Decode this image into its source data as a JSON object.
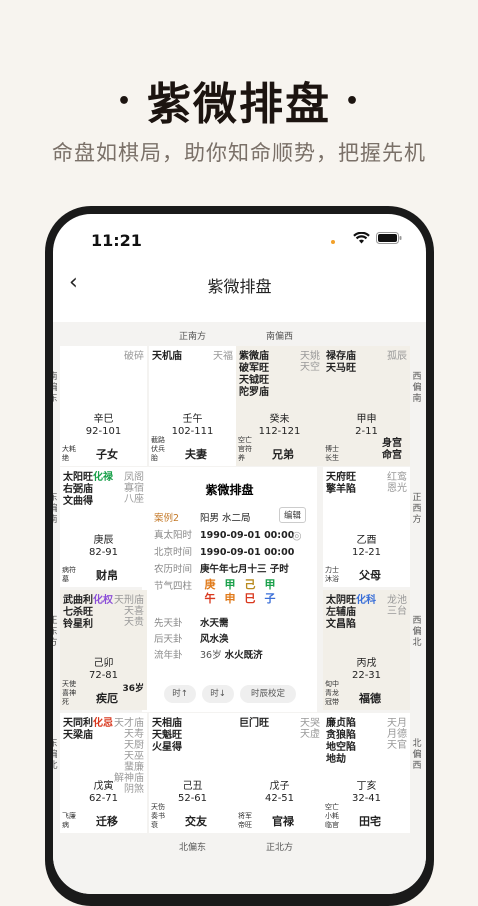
{
  "hero": {
    "title": "紫微排盘",
    "dot": "•",
    "subtitle": "命盘如棋局，助你知命顺势，把握先机"
  },
  "status": {
    "time": "11:21"
  },
  "nav": {
    "back": "‹",
    "title": "紫微排盘"
  },
  "directions": {
    "top": [
      "正南方",
      "南偏西"
    ],
    "bottom": [
      "北偏东",
      "正北方"
    ],
    "left": [
      "南偏东",
      "东偏南",
      "正东方",
      "东偏北"
    ],
    "right": [
      "西偏南",
      "正西方",
      "西偏北",
      "北偏西"
    ]
  },
  "cells": [
    {
      "id": "si",
      "stars": [],
      "minor": [
        "破碎"
      ],
      "gz": "辛巳",
      "range": "92-101",
      "bl": [
        "大耗",
        "绝"
      ],
      "palace": "子女"
    },
    {
      "id": "wu",
      "stars": [
        "天机庙"
      ],
      "minor": [
        "天福"
      ],
      "gz": "壬午",
      "range": "102-111",
      "bl": [
        "截路",
        "伏兵",
        "胎"
      ],
      "palace": "夫妻"
    },
    {
      "id": "wei",
      "stars": [
        "紫微庙",
        "破军旺",
        "天钺旺",
        "陀罗庙"
      ],
      "minor": [
        "天姚",
        "天空"
      ],
      "gz": "癸未",
      "range": "112-121",
      "bl": [
        "空亡",
        "官符",
        "养"
      ],
      "palace": "兄弟"
    },
    {
      "id": "shen",
      "stars": [
        "禄存庙",
        "天马旺"
      ],
      "minor": [
        "孤辰"
      ],
      "gz": "甲申",
      "range": "2-11",
      "bl": [
        "博士",
        "长生"
      ],
      "palace": "身宫",
      "palace2": "命宫"
    },
    {
      "id": "chen",
      "stars": [
        "太阳旺",
        "右弼庙",
        "文曲得"
      ],
      "hua": "化禄",
      "minor": [
        "凤阁",
        "寡宿",
        "八座"
      ],
      "gz": "庚辰",
      "range": "82-91",
      "bl": [
        "病符",
        "墓"
      ],
      "palace": "财帛"
    },
    {
      "id": "you",
      "stars": [
        "天府旺",
        "擎羊陷"
      ],
      "minor": [
        "红鸾",
        "恩光"
      ],
      "gz": "乙酉",
      "range": "12-21",
      "bl": [
        "力士",
        "沐浴"
      ],
      "palace": "父母"
    },
    {
      "id": "mao",
      "stars": [
        "武曲利",
        "七杀旺",
        "铃星利"
      ],
      "hua": "化权",
      "minor": [
        "天刑庙",
        "天喜",
        "天贵"
      ],
      "gz": "己卯",
      "range": "72-81",
      "age": "36岁",
      "bl": [
        "天使",
        "喜神",
        "死"
      ],
      "palace": "疾厄"
    },
    {
      "id": "xu",
      "stars": [
        "太阴旺",
        "左辅庙",
        "文昌陷"
      ],
      "hua": "化科",
      "minor": [
        "龙池",
        "三台"
      ],
      "gz": "丙戌",
      "range": "22-31",
      "bl": [
        "旬中",
        "青龙",
        "冠带"
      ],
      "palace": "福德"
    },
    {
      "id": "yin",
      "stars": [
        "天同利",
        "天梁庙"
      ],
      "hua": "化忌",
      "minor": [
        "天才庙",
        "天寿",
        "天厨",
        "天巫",
        "蜚廉",
        "解神庙",
        "阴煞"
      ],
      "gz": "戊寅",
      "range": "62-71",
      "bl": [
        "飞廉",
        "病"
      ],
      "palace": "迁移"
    },
    {
      "id": "chou",
      "stars": [
        "天相庙",
        "天魁旺",
        "火星得"
      ],
      "minor": [],
      "gz": "己丑",
      "range": "52-61",
      "bl": [
        "天伤",
        "奏书",
        "衰"
      ],
      "palace": "交友"
    },
    {
      "id": "zi",
      "stars": [
        "巨门旺"
      ],
      "minor": [
        "天哭",
        "天虚"
      ],
      "gz": "戊子",
      "range": "42-51",
      "bl": [
        "将军",
        "帝旺"
      ],
      "palace": "官禄"
    },
    {
      "id": "hai",
      "stars": [
        "廉贞陷",
        "贪狼陷",
        "地空陷",
        "地劫"
      ],
      "minor": [
        "天月",
        "月德",
        "天官"
      ],
      "gz": "丁亥",
      "range": "32-41",
      "bl": [
        "空亡",
        "小耗",
        "临官"
      ],
      "palace": "田宅"
    }
  ],
  "center": {
    "title": "紫微排盘",
    "case": "案例2",
    "gender_ju": "阳男 水二局",
    "edit": "编辑",
    "rows": [
      {
        "label": "真太阳时",
        "value": "1990-09-01 00:00"
      },
      {
        "label": "北京时间",
        "value": "1990-09-01 00:00"
      },
      {
        "label": "农历时间",
        "value": "庚午年七月十三 子时"
      }
    ],
    "jieqi_label": "节气四柱",
    "pillars": [
      {
        "top": "庚",
        "bottom": "午",
        "tc": "#e07a1a",
        "bc": "#d9381e"
      },
      {
        "top": "甲",
        "bottom": "申",
        "tc": "#19a04a",
        "bc": "#e07a1a"
      },
      {
        "top": "己",
        "bottom": "巳",
        "tc": "#b88a1e",
        "bc": "#d9381e"
      },
      {
        "top": "甲",
        "bottom": "子",
        "tc": "#19a04a",
        "bc": "#3a6fd8"
      }
    ],
    "gua": [
      {
        "label": "先天卦",
        "value": "水天需"
      },
      {
        "label": "后天卦",
        "value": "风水涣"
      },
      {
        "label": "流年卦",
        "age": "36岁",
        "value": "水火既济"
      }
    ],
    "buttons": [
      "时↑",
      "时↓",
      "时辰校定"
    ]
  },
  "colors": {
    "tint": "#f2efe8",
    "case": "#c47a2a",
    "green": "#19a04a",
    "red": "#d9381e",
    "blue": "#3a6fd8",
    "purple": "#8c4fd8"
  }
}
